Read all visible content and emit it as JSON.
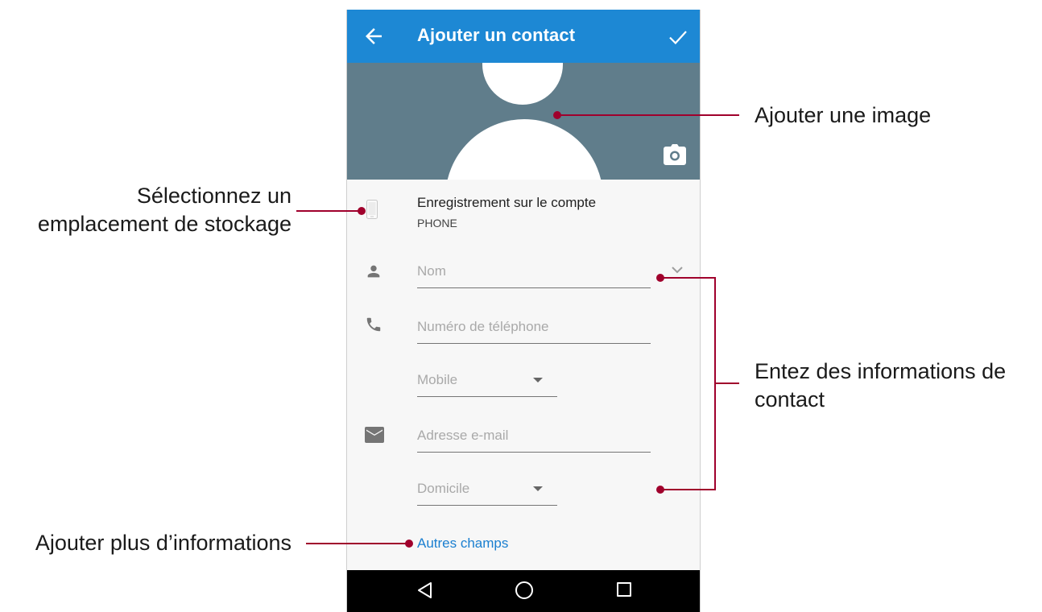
{
  "app_bar": {
    "title": "Ajouter un contact",
    "color": "#1d88d4"
  },
  "account": {
    "title": "Enregistrement sur le compte",
    "subtitle": "PHONE"
  },
  "fields": {
    "name": {
      "placeholder": "Nom"
    },
    "phone": {
      "placeholder": "Numéro de téléphone"
    },
    "phone_type": {
      "value": "Mobile"
    },
    "email": {
      "placeholder": "Adresse e-mail"
    },
    "email_type": {
      "value": "Domicile"
    }
  },
  "more_fields": "Autres champs",
  "callouts": {
    "add_image": "Ajouter une image",
    "storage_line1": "Sélectionnez un",
    "storage_line2": "emplacement de stockage",
    "contact_info_line1": "Entez des informations de",
    "contact_info_line2": "contact",
    "more_info": "Ajouter plus d’informations"
  },
  "icons": [
    "back-arrow-icon",
    "checkmark-icon",
    "camera-icon",
    "smartphone-icon",
    "person-icon",
    "phone-handset-icon",
    "email-envelope-icon",
    "chevron-down-icon",
    "dropdown-arrow-icon",
    "nav-back-icon",
    "nav-home-icon",
    "nav-recents-icon"
  ],
  "colors": {
    "photo_background": "#607d8b",
    "leader_line": "#a0002c",
    "link": "#1a7fd0"
  }
}
